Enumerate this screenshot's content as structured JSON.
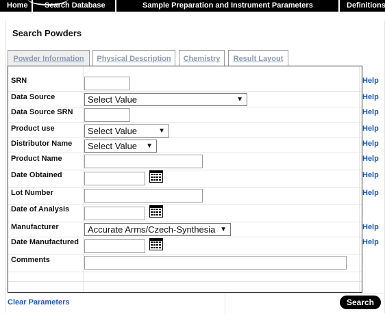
{
  "nav": {
    "home": "Home",
    "search_database": "Search Database",
    "sample_prep": "Sample Preparation and Instrument Parameters",
    "definitions": "Definitions"
  },
  "page_title": "Search Powders",
  "tabs": [
    {
      "label": "Powder Information",
      "active": true
    },
    {
      "label": "Physical Description",
      "active": false
    },
    {
      "label": "Chemistry",
      "active": false
    },
    {
      "label": "Result Layout",
      "active": false
    }
  ],
  "fields": {
    "srn": {
      "label": "SRN",
      "value": ""
    },
    "data_source": {
      "label": "Data Source",
      "selected": "Select Value"
    },
    "data_source_srn": {
      "label": "Data Source SRN",
      "value": ""
    },
    "product_use": {
      "label": "Product use",
      "selected": "Select Value"
    },
    "distributor_name": {
      "label": "Distributor Name",
      "selected": "Select Value"
    },
    "product_name": {
      "label": "Product Name",
      "value": ""
    },
    "date_obtained": {
      "label": "Date Obtained",
      "value": ""
    },
    "lot_number": {
      "label": "Lot Number",
      "value": ""
    },
    "date_of_analysis": {
      "label": "Date of Analysis",
      "value": ""
    },
    "manufacturer": {
      "label": "Manufacturer",
      "selected": "Accurate Arms/Czech-Synthesia"
    },
    "date_manufactured": {
      "label": "Date Manufactured",
      "value": ""
    },
    "comments": {
      "label": "Comments",
      "value": ""
    }
  },
  "help_label": "Help",
  "clear_label": "Clear Parameters",
  "search_label": "Search",
  "icons": {
    "dropdown": "chevron-down-icon",
    "calendar": "calendar-icon"
  },
  "colors": {
    "link": "#1a56c4",
    "tab_text": "#8a9bb5",
    "nav_bg": "#000000"
  }
}
